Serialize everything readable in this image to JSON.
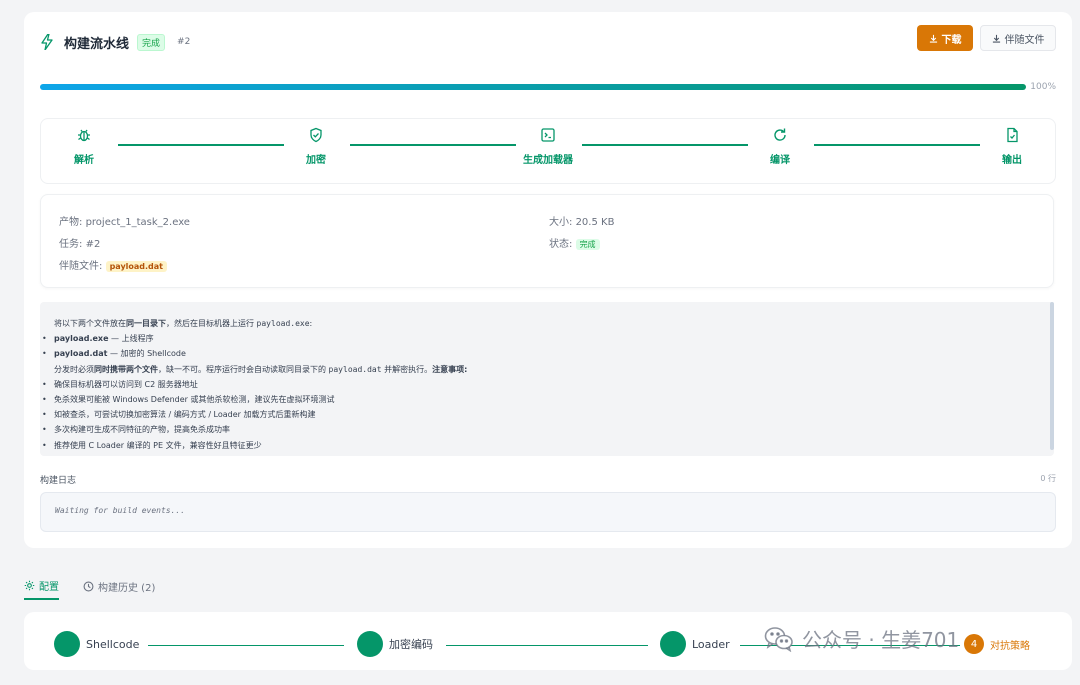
{
  "header": {
    "title": "构建流水线",
    "status_badge": "完成",
    "task_id": "#2",
    "download_label": "下载",
    "companion_label": "伴随文件"
  },
  "progress": {
    "percent_label": "100%",
    "value": 1.0
  },
  "steps": [
    {
      "label": "解析",
      "icon": "bug-icon"
    },
    {
      "label": "加密",
      "icon": "shield-icon"
    },
    {
      "label": "生成加载器",
      "icon": "terminal-icon"
    },
    {
      "label": "编译",
      "icon": "refresh-icon"
    },
    {
      "label": "输出",
      "icon": "file-icon"
    }
  ],
  "info": {
    "artifact_label": "产物:",
    "artifact_value": "project_1_task_2.exe",
    "size_label": "大小:",
    "size_value": "20.5 KB",
    "task_label": "任务:",
    "task_value": "#2",
    "status_label": "状态:",
    "status_value": "完成",
    "companion_label": "伴随文件:",
    "companion_value": "payload.dat"
  },
  "instructions": {
    "intro_a": "将以下两个文件放在",
    "intro_b": "同一目录下",
    "intro_c": "，然后在目标机器上运行",
    "intro_d": "payload.exe",
    "intro_e": ":",
    "b1_name": "payload.exe",
    "b1_desc": " — 上线程序",
    "b2_name": "payload.dat",
    "b2_desc": " — 加密的 Shellcode",
    "note_a": "分发时必须",
    "note_b": "同时携带两个文件",
    "note_c": "，缺一不可。程序运行时会自动读取同目录下的",
    "note_d": "payload.dat",
    "note_e": "并解密执行。",
    "note_f": "注意事项:",
    "tips": [
      "确保目标机器可以访问到 C2 服务器地址",
      "免杀效果可能被 Windows Defender 或其他杀软检测，建议先在虚拟环境测试",
      "如被查杀，可尝试切换加密算法 / 编码方式 / Loader 加载方式后重新构建",
      "多次构建可生成不同特征的产物，提高免杀成功率",
      "推荐使用 C Loader 编译的 PE 文件，兼容性好且特征更少"
    ]
  },
  "log": {
    "title": "构建日志",
    "count": "0 行",
    "placeholder": "Waiting for build events..."
  },
  "tabs": [
    {
      "label": "配置",
      "active": true,
      "icon": "gear-icon"
    },
    {
      "label": "构建历史 (2)",
      "active": false,
      "icon": "history-icon"
    }
  ],
  "config_steps": [
    {
      "label": "Shellcode"
    },
    {
      "label": "加密编码"
    },
    {
      "label": "Loader"
    }
  ],
  "config_extra": {
    "label": "对抗策略",
    "mark": "4"
  },
  "watermark": {
    "text": "公众号 · 生姜701"
  },
  "colors": {
    "primary": "#059669",
    "accent": "#d97706",
    "progress_start": "#0ea5e9"
  }
}
